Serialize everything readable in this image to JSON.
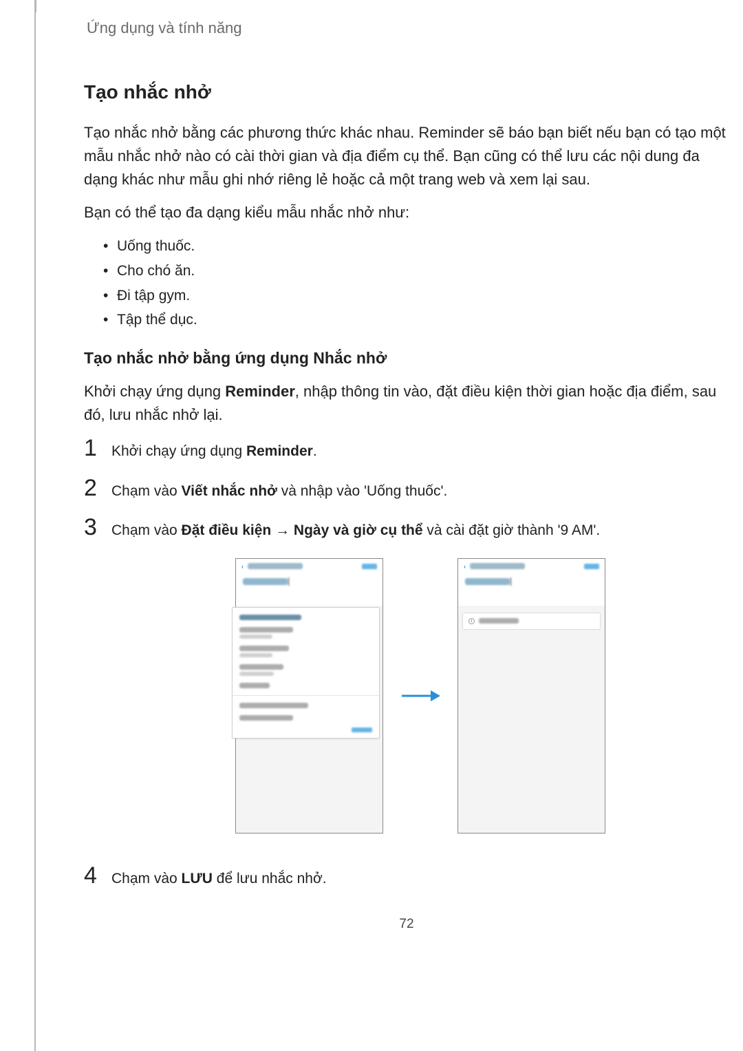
{
  "breadcrumb": "Ứng dụng và tính năng",
  "section_title": "Tạo nhắc nhở",
  "intro_para": "Tạo nhắc nhở bằng các phương thức khác nhau. Reminder sẽ báo bạn biết nếu bạn có tạo một mẫu nhắc nhở nào có cài thời gian và địa điểm cụ thể. Bạn cũng có thể lưu các nội dung đa dạng khác như mẫu ghi nhớ riêng lẻ hoặc cả một trang web và xem lại sau.",
  "intro_line2": "Bạn có thể tạo đa dạng kiểu mẫu nhắc nhở như:",
  "bullets": [
    "Uống thuốc.",
    "Cho chó ăn.",
    "Đi tập gym.",
    "Tập thể dục."
  ],
  "subsection_title": "Tạo nhắc nhở bằng ứng dụng Nhắc nhở",
  "sub_intro_pre": "Khởi chạy ứng dụng ",
  "sub_intro_bold": "Reminder",
  "sub_intro_post": ", nhập thông tin vào, đặt điều kiện thời gian hoặc địa điểm, sau đó, lưu nhắc nhở lại.",
  "steps": {
    "s1_num": "1",
    "s1_pre": "Khởi chạy ứng dụng ",
    "s1_bold": "Reminder",
    "s1_post": ".",
    "s2_num": "2",
    "s2_pre": "Chạm vào ",
    "s2_bold": "Viết nhắc nhở",
    "s2_post": " và nhập vào 'Uống thuốc'.",
    "s3_num": "3",
    "s3_pre": "Chạm vào ",
    "s3_bold1": "Đặt điều kiện",
    "s3_arrow": " → ",
    "s3_bold2": "Ngày và giờ cụ thể",
    "s3_post": " và cài đặt giờ thành '9 AM'.",
    "s4_num": "4",
    "s4_pre": "Chạm vào ",
    "s4_bold": "LƯU",
    "s4_post": " để lưu nhắc nhở."
  },
  "page_number": "72"
}
